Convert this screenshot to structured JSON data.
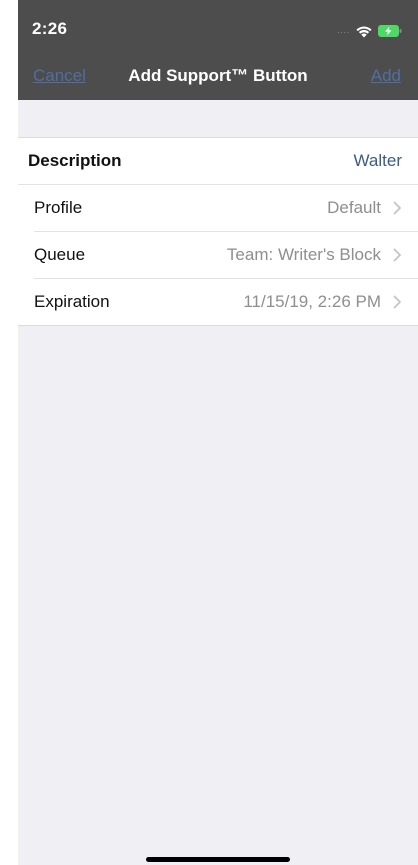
{
  "status_bar": {
    "time": "2:26",
    "signal_dots": "....",
    "wifi_icon": "wifi-icon",
    "battery_icon": "battery-charging-icon",
    "battery_color": "#4cd964"
  },
  "nav": {
    "cancel_label": "Cancel",
    "title": "Add Support™ Button",
    "add_label": "Add",
    "link_color": "#4f6ea3",
    "bar_color": "#4d4d4d"
  },
  "rows": [
    {
      "label": "Description",
      "value": "Walter",
      "chevron": false
    },
    {
      "label": "Profile",
      "value": "Default",
      "chevron": true,
      "icon": "chevron-right-icon"
    },
    {
      "label": "Queue",
      "value": "Team: Writer's Block",
      "chevron": true,
      "icon": "chevron-right-icon"
    },
    {
      "label": "Expiration",
      "value": "11/15/19, 2:26 PM",
      "chevron": true,
      "icon": "chevron-right-icon"
    }
  ]
}
